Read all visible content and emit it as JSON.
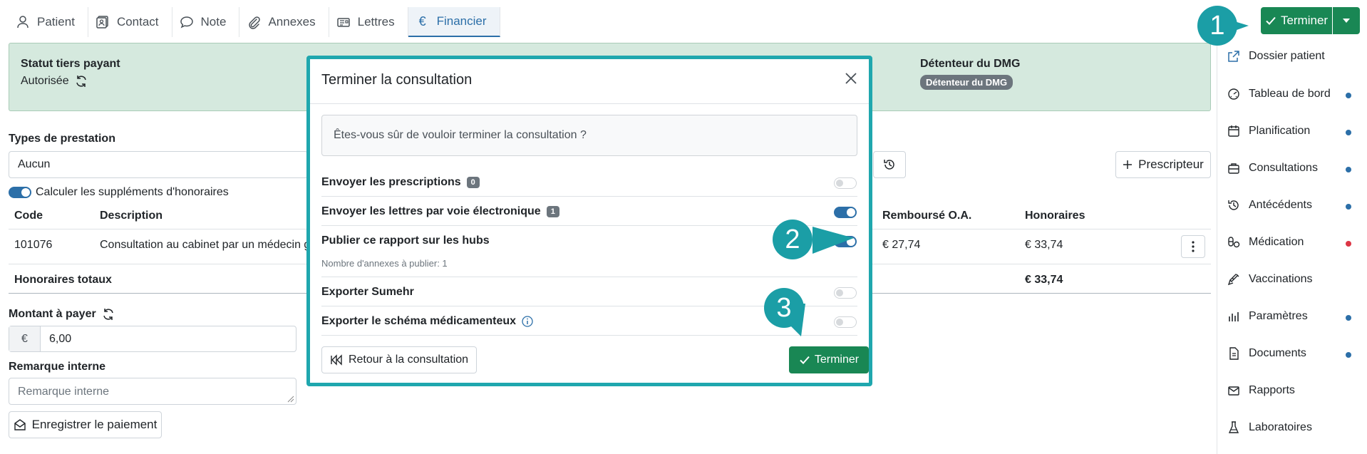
{
  "tabs": [
    {
      "label": "Patient",
      "icon": "user-icon"
    },
    {
      "label": "Contact",
      "icon": "contact-card-icon"
    },
    {
      "label": "Note",
      "icon": "speech-bubble-icon"
    },
    {
      "label": "Annexes",
      "icon": "paperclip-icon"
    },
    {
      "label": "Lettres",
      "icon": "letters-icon"
    },
    {
      "label": "Financier",
      "icon": "euro-icon",
      "active": true
    }
  ],
  "status": {
    "tiers_payant_label": "Statut tiers payant",
    "tiers_payant_value": "Autorisée",
    "dmg_label": "Détenteur du DMG",
    "dmg_badge": "Détenteur du DMG"
  },
  "prestation": {
    "label": "Types de prestation",
    "value": "Aucun",
    "supplements_label": "Calculer les suppléments d'honoraires",
    "prescripteur_button": "Prescripteur"
  },
  "table": {
    "headers": {
      "code": "Code",
      "description": "Description",
      "rembourse": "Remboursé O.A.",
      "honoraires": "Honoraires"
    },
    "rows": [
      {
        "code": "101076",
        "description": "Consultation au cabinet par un médecin g",
        "rembourse": "€ 27,74",
        "honoraires": "€ 33,74"
      }
    ],
    "total_label": "Honoraires totaux",
    "total_value": "€ 33,74"
  },
  "payment": {
    "amount_label": "Montant à payer",
    "currency": "€",
    "amount_value": "6,00",
    "remark_label": "Remarque interne",
    "remark_placeholder": "Remarque interne",
    "save_button": "Enregistrer le paiement"
  },
  "header_button": {
    "label": "Terminer"
  },
  "sidebar": {
    "items": [
      {
        "label": "Dossier patient",
        "icon": "external-link-icon",
        "dot": null
      },
      {
        "label": "Tableau de bord",
        "icon": "dashboard-icon",
        "dot": "#2c6fa8"
      },
      {
        "label": "Planification",
        "icon": "calendar-icon",
        "dot": "#2c6fa8"
      },
      {
        "label": "Consultations",
        "icon": "briefcase-icon",
        "dot": "#2c6fa8"
      },
      {
        "label": "Antécédents",
        "icon": "history-icon",
        "dot": "#2c6fa8"
      },
      {
        "label": "Médication",
        "icon": "pill-icon",
        "dot": "#dc3545"
      },
      {
        "label": "Vaccinations",
        "icon": "syringe-icon",
        "dot": null
      },
      {
        "label": "Paramètres",
        "icon": "chart-bars-icon",
        "dot": "#2c6fa8"
      },
      {
        "label": "Documents",
        "icon": "document-icon",
        "dot": "#2c6fa8"
      },
      {
        "label": "Rapports",
        "icon": "envelope-icon",
        "dot": null
      },
      {
        "label": "Laboratoires",
        "icon": "flask-icon",
        "dot": null
      }
    ]
  },
  "modal": {
    "title": "Terminer la consultation",
    "question": "Êtes-vous sûr de vouloir terminer la consultation ?",
    "rows": [
      {
        "label": "Envoyer les prescriptions",
        "count": "0",
        "enabled": false
      },
      {
        "label": "Envoyer les lettres par voie électronique",
        "count": "1",
        "enabled": true
      },
      {
        "label": "Publier ce rapport sur les hubs",
        "sub": "Nombre d'annexes à publier: 1",
        "enabled": true
      },
      {
        "label": "Exporter Sumehr",
        "enabled": false
      },
      {
        "label": "Exporter le schéma médicamenteux",
        "info": true,
        "enabled": false
      }
    ],
    "back_button": "Retour à la consultation",
    "confirm_button": "Terminer"
  },
  "markers": [
    "1",
    "2",
    "3"
  ],
  "colors": {
    "accent": "#2c6fa8",
    "success": "#198754",
    "callout": "#1b9ea6",
    "status_bg": "#d5e9de",
    "danger": "#dc3545"
  }
}
